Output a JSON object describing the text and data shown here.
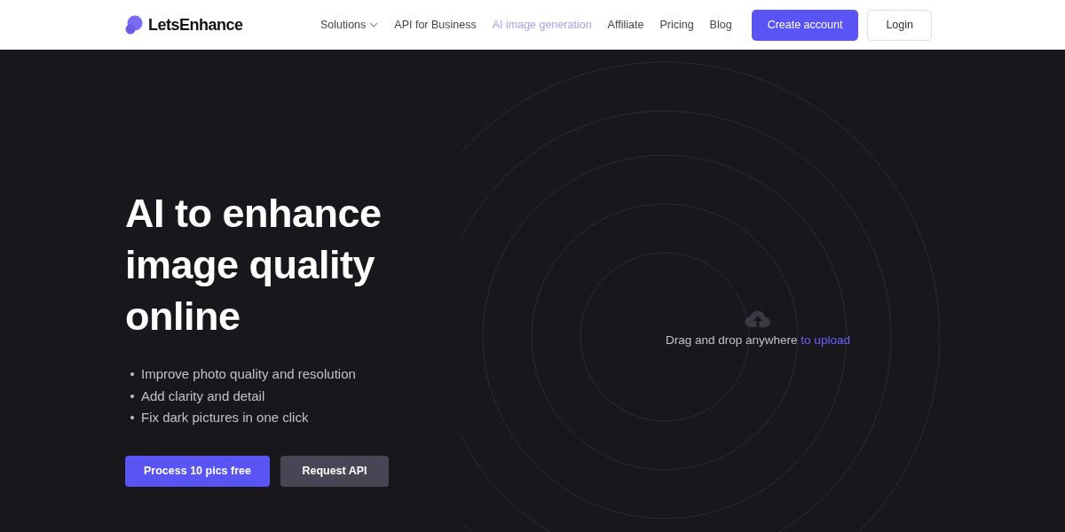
{
  "header": {
    "brand": "LetsEnhance",
    "nav": [
      {
        "label": "Solutions",
        "kind": "dropdown",
        "selected": false
      },
      {
        "label": "API for Business",
        "kind": "link",
        "selected": false
      },
      {
        "label": "AI image generation",
        "kind": "link",
        "selected": true
      },
      {
        "label": "Affiliate",
        "kind": "link",
        "selected": false
      },
      {
        "label": "Pricing",
        "kind": "link",
        "selected": false
      },
      {
        "label": "Blog",
        "kind": "link",
        "selected": false
      }
    ],
    "create_account": "Create account",
    "login": "Login"
  },
  "hero": {
    "title_lines": [
      "AI to enhance",
      "image quality online"
    ],
    "bullets": [
      "Improve photo quality and resolution",
      "Add clarity and detail",
      "Fix dark pictures in one click"
    ],
    "primary_button": "Process 10 pics free",
    "secondary_button": "Request API"
  },
  "upload": {
    "prompt": "Drag and drop anywhere",
    "link": "to upload"
  }
}
